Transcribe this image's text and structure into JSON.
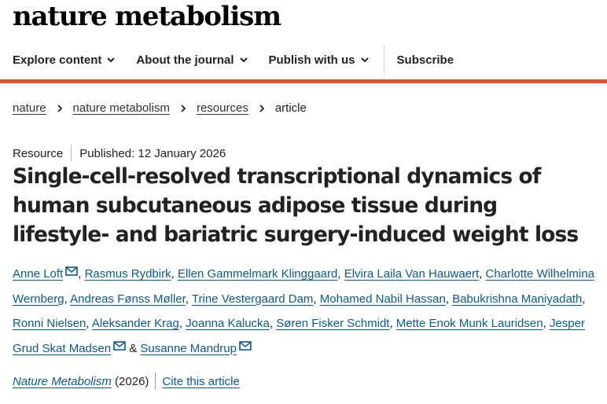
{
  "brand": {
    "name": "nature metabolism"
  },
  "nav": {
    "items": [
      {
        "label": "Explore content"
      },
      {
        "label": "About the journal"
      },
      {
        "label": "Publish with us"
      }
    ],
    "subscribe": "Subscribe",
    "accent_color": "#e1522e"
  },
  "breadcrumb": {
    "items": [
      "nature",
      "nature metabolism",
      "resources"
    ],
    "current": "article"
  },
  "article": {
    "type": "Resource",
    "published": "Published: 12 January 2026",
    "title": "Single-cell-resolved transcriptional dynamics of human subcutaneous adipose tissue during lifestyle- and bariatric surgery-induced weight loss",
    "authors": [
      {
        "name": "Anne Loft",
        "mail": true
      },
      {
        "name": "Rasmus Rydbirk",
        "mail": false
      },
      {
        "name": "Ellen Gammelmark Klinggaard",
        "mail": false
      },
      {
        "name": "Elvira Laila Van Hauwaert",
        "mail": false
      },
      {
        "name": "Charlotte Wilhelmina Wernberg",
        "mail": false
      },
      {
        "name": "Andreas Fønss Møller",
        "mail": false
      },
      {
        "name": "Trine Vestergaard Dam",
        "mail": false
      },
      {
        "name": "Mohamed Nabil Hassan",
        "mail": false
      },
      {
        "name": "Babukrishna Maniyadath",
        "mail": false
      },
      {
        "name": "Ronni Nielsen",
        "mail": false
      },
      {
        "name": "Aleksander Krag",
        "mail": false
      },
      {
        "name": "Joanna Kalucka",
        "mail": false
      },
      {
        "name": "Søren Fisker Schmidt",
        "mail": false
      },
      {
        "name": "Mette Enok Munk Lauridsen",
        "mail": false
      },
      {
        "name": "Jesper Grud Skat Madsen",
        "mail": true
      },
      {
        "name": "Susanne Mandrup",
        "mail": true
      }
    ],
    "separator": ", ",
    "final_separator": " & ",
    "journal": "Nature Metabolism",
    "year": "(2026)",
    "cite_label": "Cite this article",
    "link_color": "#0c5a8f"
  }
}
